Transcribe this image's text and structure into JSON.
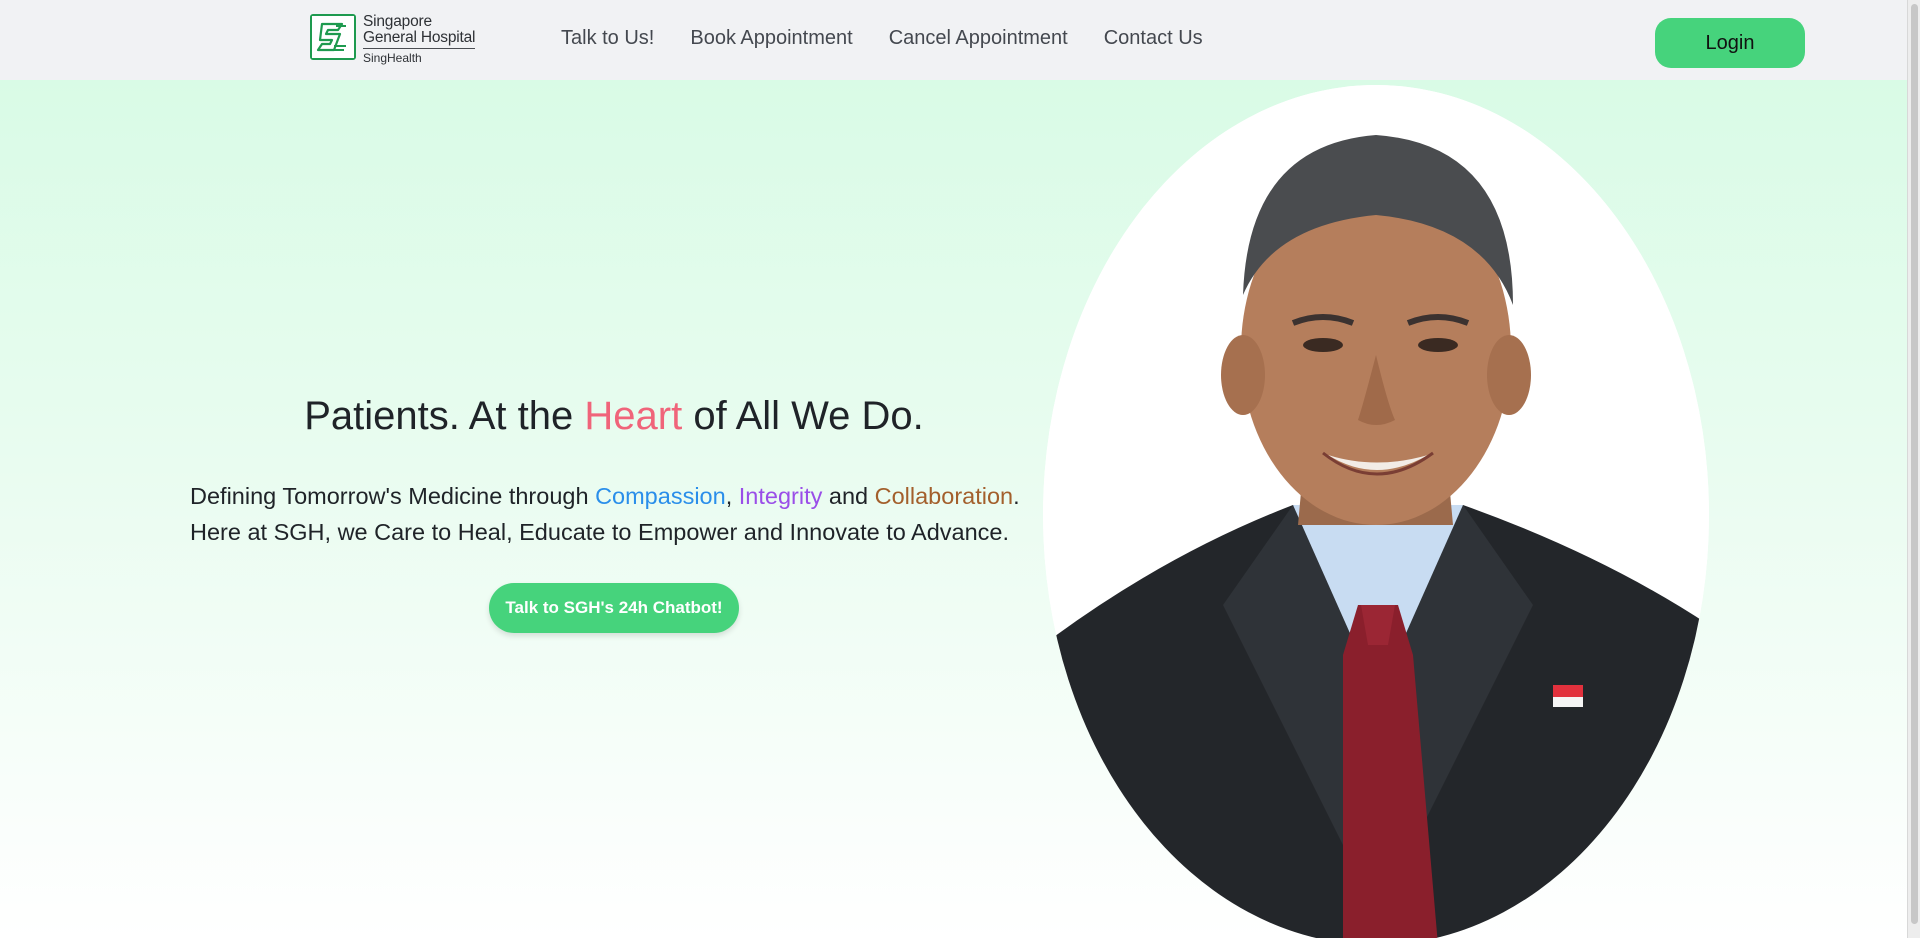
{
  "header": {
    "logo": {
      "line1": "Singapore",
      "line2": "General Hospital",
      "line3": "SingHealth"
    },
    "nav": [
      {
        "label": "Talk to Us!"
      },
      {
        "label": "Book Appointment"
      },
      {
        "label": "Cancel Appointment"
      },
      {
        "label": "Contact Us"
      }
    ],
    "login_label": "Login"
  },
  "hero": {
    "headline": {
      "before": "Patients. At the ",
      "accent": "Heart",
      "after": " of All We Do."
    },
    "tagline": {
      "prefix": "Defining Tomorrow's Medicine through ",
      "word1": "Compassion",
      "sep1": ", ",
      "word2": "Integrity",
      "sep2": " and ",
      "word3": "Collaboration",
      "end": "."
    },
    "subtext": "Here at SGH, we Care to Heal, Educate to Empower and Innovate to Advance.",
    "cta_label": "Talk to SGH's 24h Chatbot!"
  },
  "colors": {
    "brand_green": "#46d37c",
    "accent_pink": "#f0647a",
    "compassion_blue": "#2a8eea",
    "integrity_purple": "#9a4ee8",
    "collaboration_brown": "#a35f2c"
  }
}
